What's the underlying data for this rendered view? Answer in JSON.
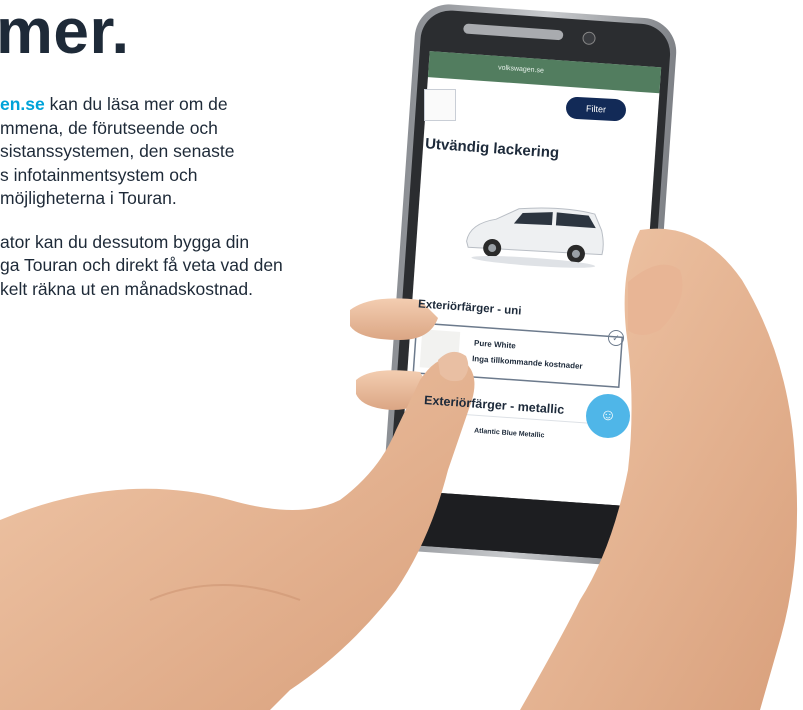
{
  "article": {
    "headline": "mer.",
    "para1_link": "en.se",
    "para1_lines": [
      " kan du läsa mer om de",
      "mmena, de förutseende och",
      "sistanssystemen, den senaste",
      "s infotainmentsystem och",
      "möjligheterna i Touran."
    ],
    "para2_lines": [
      "ator kan du dessutom bygga din",
      "ga Touran och direkt få veta vad den",
      "kelt räkna ut en månadskostnad."
    ]
  },
  "phone_screen": {
    "url": "volkswagen.se",
    "filter_button": "Filter",
    "section_title": "Utvändig lackering",
    "uni_heading": "Exteriörfärger - uni",
    "color_name": "Pure White",
    "color_note": "Inga tillkommande kostnader",
    "metallic_heading": "Exteriörfärger - metallic",
    "next_color": "Atlantic Blue Metallic"
  },
  "colors": {
    "link": "#00a3d9",
    "text": "#1e2a38",
    "filter_button": "#122a57",
    "fab": "#4fb6e8"
  }
}
